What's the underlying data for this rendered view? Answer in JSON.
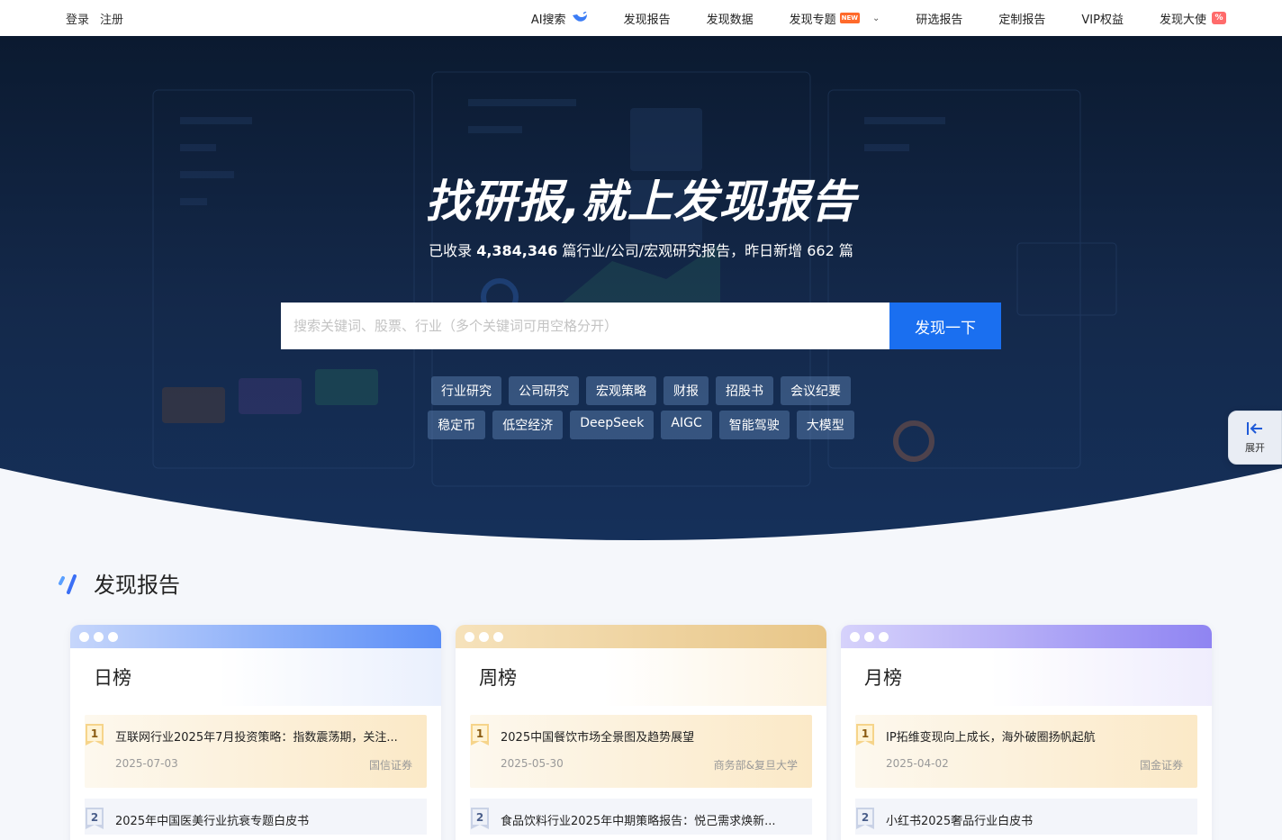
{
  "auth": {
    "login": "登录",
    "register": "注册"
  },
  "nav": [
    {
      "label": "AI搜索"
    },
    {
      "label": "发现报告"
    },
    {
      "label": "发现数据"
    },
    {
      "label": "发现专题",
      "badge": "NEW"
    },
    {
      "label": "研选报告"
    },
    {
      "label": "定制报告"
    },
    {
      "label": "VIP权益"
    },
    {
      "label": "发现大使"
    }
  ],
  "hero": {
    "title": "找研报,就上发现报告",
    "sub_prefix": "已收录 ",
    "total": "4,384,346",
    "sub_middle": " 篇行业/公司/宏观研究报告，昨日新增 ",
    "daily": "662",
    "sub_suffix": " 篇"
  },
  "search": {
    "placeholder": "搜索关键词、股票、行业（多个关键词可用空格分开）",
    "button": "发现一下"
  },
  "tags_row1": [
    "行业研究",
    "公司研究",
    "宏观策略",
    "财报",
    "招股书",
    "会议纪要"
  ],
  "tags_row2": [
    "稳定币",
    "低空经济",
    "DeepSeek",
    "AIGC",
    "智能驾驶",
    "大模型"
  ],
  "side": {
    "label": "展开"
  },
  "section": {
    "title": "发现报告"
  },
  "boards": [
    {
      "title": "日榜",
      "items": [
        {
          "rank": "1",
          "title": "互联网行业2025年7月投资策略：指数震荡期，关注...",
          "date": "2025-07-03",
          "source": "国信证券"
        },
        {
          "rank": "2",
          "title": "2025年中国医美行业抗衰专题白皮书",
          "date": "",
          "source": ""
        }
      ]
    },
    {
      "title": "周榜",
      "items": [
        {
          "rank": "1",
          "title": "2025中国餐饮市场全景图及趋势展望",
          "date": "2025-05-30",
          "source": "商务部&复旦大学"
        },
        {
          "rank": "2",
          "title": "食品饮料行业2025年中期策略报告：悦己需求焕新...",
          "date": "",
          "source": ""
        }
      ]
    },
    {
      "title": "月榜",
      "items": [
        {
          "rank": "1",
          "title": "IP拓维变现向上成长，海外破圈扬帆起航",
          "date": "2025-04-02",
          "source": "国金证券"
        },
        {
          "rank": "2",
          "title": "小红书2025奢品行业白皮书",
          "date": "",
          "source": ""
        }
      ]
    }
  ],
  "colors": {
    "primary": "#1a6ff0",
    "hero_dark": "#0b1a30",
    "day_bar": "#5b8ef7",
    "week_bar": "#e8c688",
    "month_bar": "#8f84f2"
  }
}
